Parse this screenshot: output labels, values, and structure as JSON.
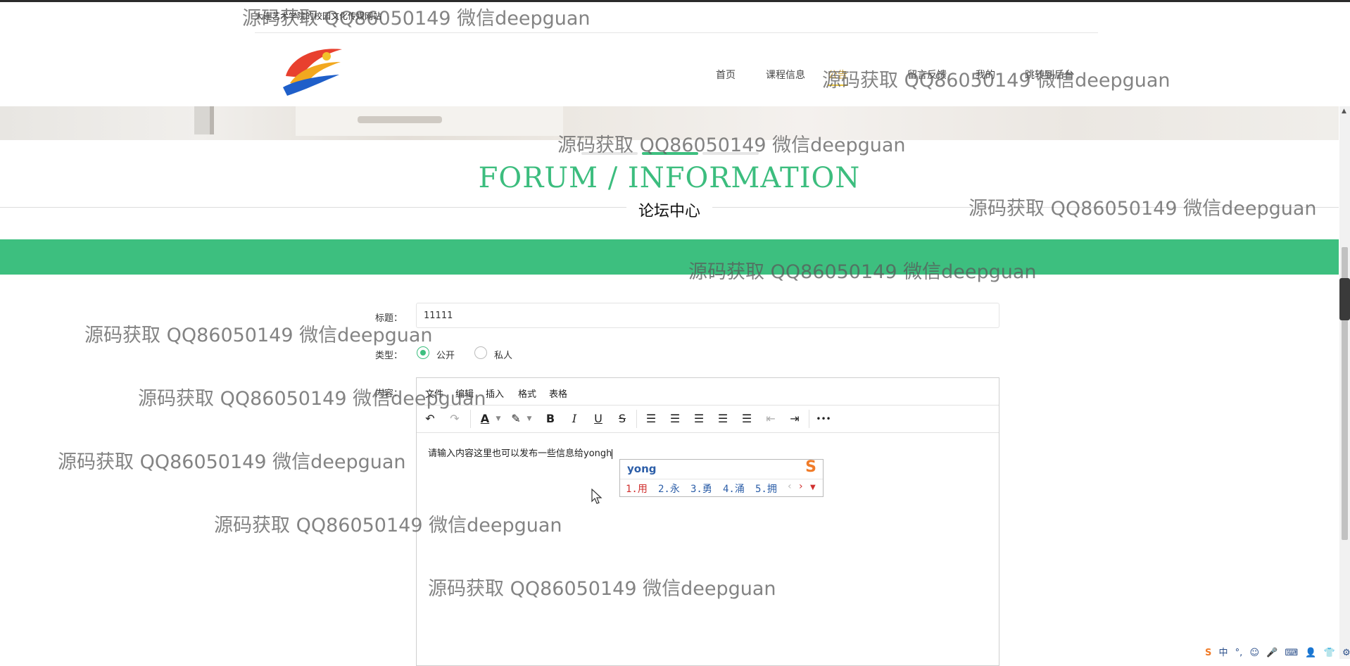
{
  "site": {
    "title": "大连艺术学院的校园文化传媒网站",
    "logo_icon": "site-logo-icon"
  },
  "nav": {
    "items": [
      {
        "label": "首页",
        "active": false
      },
      {
        "label": "课程信息",
        "active": false
      },
      {
        "label": "公告",
        "active": true
      },
      {
        "label": "留言反馈",
        "active": false
      },
      {
        "label": "我的",
        "active": false
      },
      {
        "label": "跳转到后台",
        "active": false
      }
    ]
  },
  "forum": {
    "heading_en": "FORUM / INFORMATION",
    "heading_cn": "论坛中心"
  },
  "form": {
    "title_label": "标题：",
    "title_value": "11111",
    "type_label": "类型：",
    "type_options": [
      {
        "label": "公开",
        "selected": true
      },
      {
        "label": "私人",
        "selected": false
      }
    ],
    "content_label": "内容："
  },
  "editor": {
    "menubar": [
      "文件",
      "编辑",
      "插入",
      "格式",
      "表格"
    ],
    "toolbar": [
      {
        "icon": "undo-icon",
        "glyph": "↶"
      },
      {
        "icon": "redo-icon",
        "glyph": "↷"
      },
      {
        "icon": "font-color-icon",
        "glyph": "A"
      },
      {
        "icon": "background-color-icon",
        "glyph": "✎"
      },
      {
        "icon": "bold-icon",
        "glyph": "B"
      },
      {
        "icon": "italic-icon",
        "glyph": "I"
      },
      {
        "icon": "underline-icon",
        "glyph": "U"
      },
      {
        "icon": "strikethrough-icon",
        "glyph": "S"
      },
      {
        "icon": "numbered-list-icon",
        "glyph": "☰"
      },
      {
        "icon": "align-left-icon",
        "glyph": "☰"
      },
      {
        "icon": "align-center-icon",
        "glyph": "☰"
      },
      {
        "icon": "align-right-icon",
        "glyph": "☰"
      },
      {
        "icon": "align-justify-icon",
        "glyph": "☰"
      },
      {
        "icon": "outdent-icon",
        "glyph": "⇤"
      },
      {
        "icon": "indent-icon",
        "glyph": "⇥"
      },
      {
        "icon": "more-icon",
        "glyph": "•••"
      }
    ],
    "content_text": "请输入内容这里也可以发布一些信息给yongh"
  },
  "ime": {
    "input": "yong",
    "candidates": [
      "1.用",
      "2.永",
      "3.勇",
      "4.涌",
      "5.拥"
    ],
    "logo": "S",
    "prev_icon": "chevron-left-icon",
    "next_icon": "chevron-right-icon",
    "expand_icon": "chevron-down-icon"
  },
  "tray": {
    "items": [
      "S",
      "中",
      "°,",
      "☺",
      "🎤",
      "⌨",
      "👤",
      "👕",
      "⚙"
    ]
  },
  "watermark_text": "源码获取 QQ86050149 微信deepguan",
  "colors": {
    "accent_green": "#3dbf7f",
    "nav_active": "#e8c33c",
    "ime_blue": "#2c5ea8",
    "ime_red": "#d0302f",
    "ime_orange": "#f07b28"
  }
}
